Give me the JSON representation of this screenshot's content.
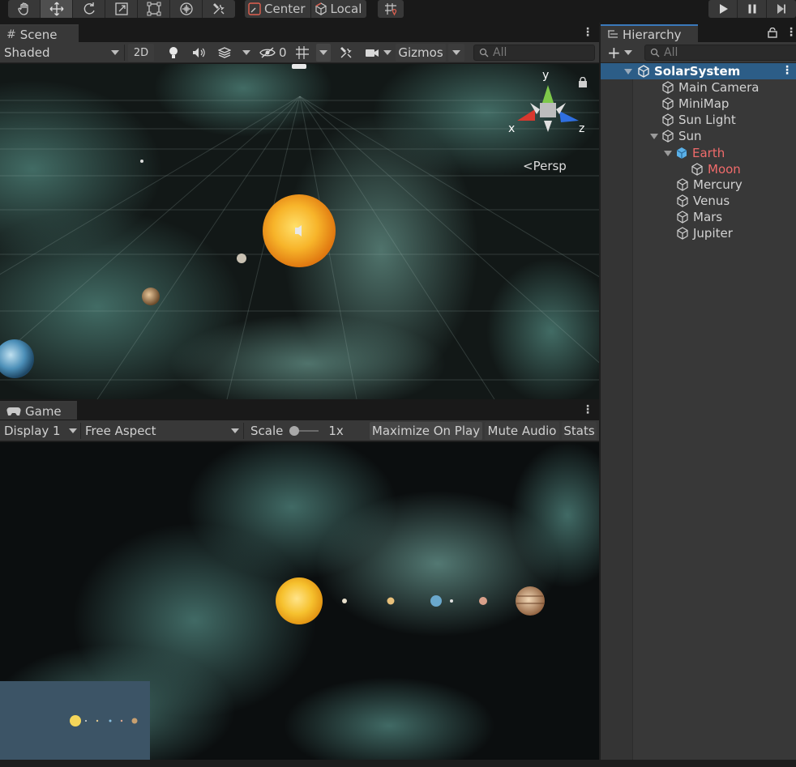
{
  "toolbar": {
    "tools": [
      "hand-tool",
      "move-tool",
      "rotate-tool",
      "scale-tool",
      "rect-tool",
      "transform-tool",
      "custom-editor-tool"
    ],
    "pivot_mode": "Center",
    "pivot_rotation": "Local"
  },
  "scene": {
    "tab_label": "Scene",
    "draw_mode": "Shaded",
    "mode_2d": "2D",
    "hidden_count": "0",
    "gizmos_label": "Gizmos",
    "search_placeholder": "All",
    "axis_x": "x",
    "axis_y": "y",
    "axis_z": "z",
    "projection": "Persp"
  },
  "game": {
    "tab_label": "Game",
    "display": "Display 1",
    "aspect": "Free Aspect",
    "scale_label": "Scale",
    "scale_value": "1x",
    "maximize_label": "Maximize On Play",
    "mute_label": "Mute Audio",
    "stats_label": "Stats"
  },
  "hierarchy": {
    "tab_label": "Hierarchy",
    "search_placeholder": "All",
    "items": [
      {
        "label": "SolarSystem"
      },
      {
        "label": "Main Camera"
      },
      {
        "label": "MiniMap"
      },
      {
        "label": "Sun Light"
      },
      {
        "label": "Sun"
      },
      {
        "label": "Earth"
      },
      {
        "label": "Moon"
      },
      {
        "label": "Mercury"
      },
      {
        "label": "Venus"
      },
      {
        "label": "Mars"
      },
      {
        "label": "Jupiter"
      }
    ]
  },
  "colors": {
    "editor_bg": "#383838",
    "selection": "#2c5d87",
    "prefab_override_red": "#f06b6b",
    "sun": "#f5b92a",
    "minimap_bg": "#3c5466"
  }
}
